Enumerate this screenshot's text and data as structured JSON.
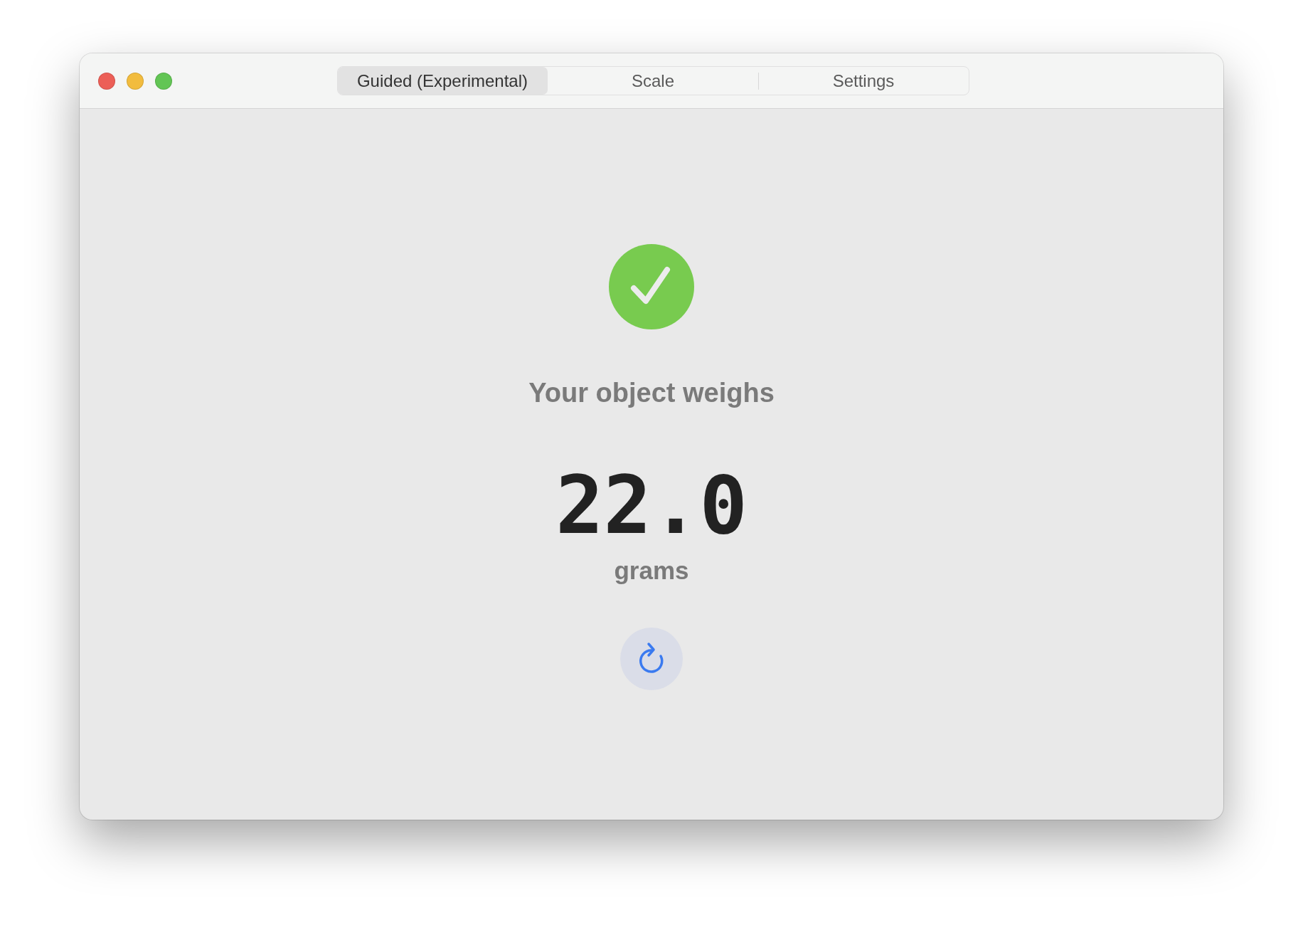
{
  "window": {
    "controls": [
      {
        "color": "#ec5f57"
      },
      {
        "color": "#f2bc3e"
      },
      {
        "color": "#62c554"
      }
    ]
  },
  "tabs": [
    {
      "label": "Guided (Experimental)",
      "selected": true
    },
    {
      "label": "Scale",
      "selected": false
    },
    {
      "label": "Settings",
      "selected": false
    }
  ],
  "result": {
    "success": true,
    "heading": "Your object weighs",
    "value": "22.0",
    "unit": "grams"
  }
}
